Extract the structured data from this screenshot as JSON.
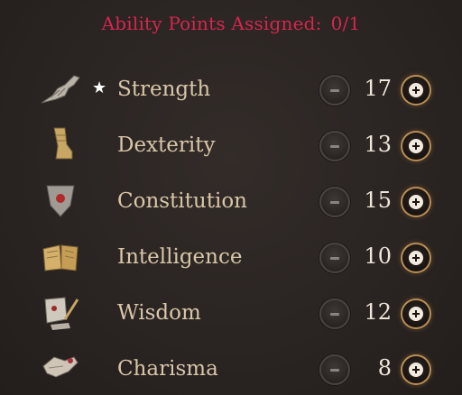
{
  "header": {
    "label": "Ability Points Assigned:",
    "count": "0/1"
  },
  "abilities": [
    {
      "name": "Strength",
      "value": "17",
      "starred": true,
      "icon": "strength-icon"
    },
    {
      "name": "Dexterity",
      "value": "13",
      "starred": false,
      "icon": "dexterity-icon"
    },
    {
      "name": "Constitution",
      "value": "15",
      "starred": false,
      "icon": "constitution-icon"
    },
    {
      "name": "Intelligence",
      "value": "10",
      "starred": false,
      "icon": "intelligence-icon"
    },
    {
      "name": "Wisdom",
      "value": "12",
      "starred": false,
      "icon": "wisdom-icon"
    },
    {
      "name": "Charisma",
      "value": "8",
      "starred": false,
      "icon": "charisma-icon"
    }
  ],
  "colors": {
    "header": "#d6264e",
    "label": "#d9c6a8",
    "value": "#efe6d8",
    "plus_ring": "#b88e55"
  }
}
